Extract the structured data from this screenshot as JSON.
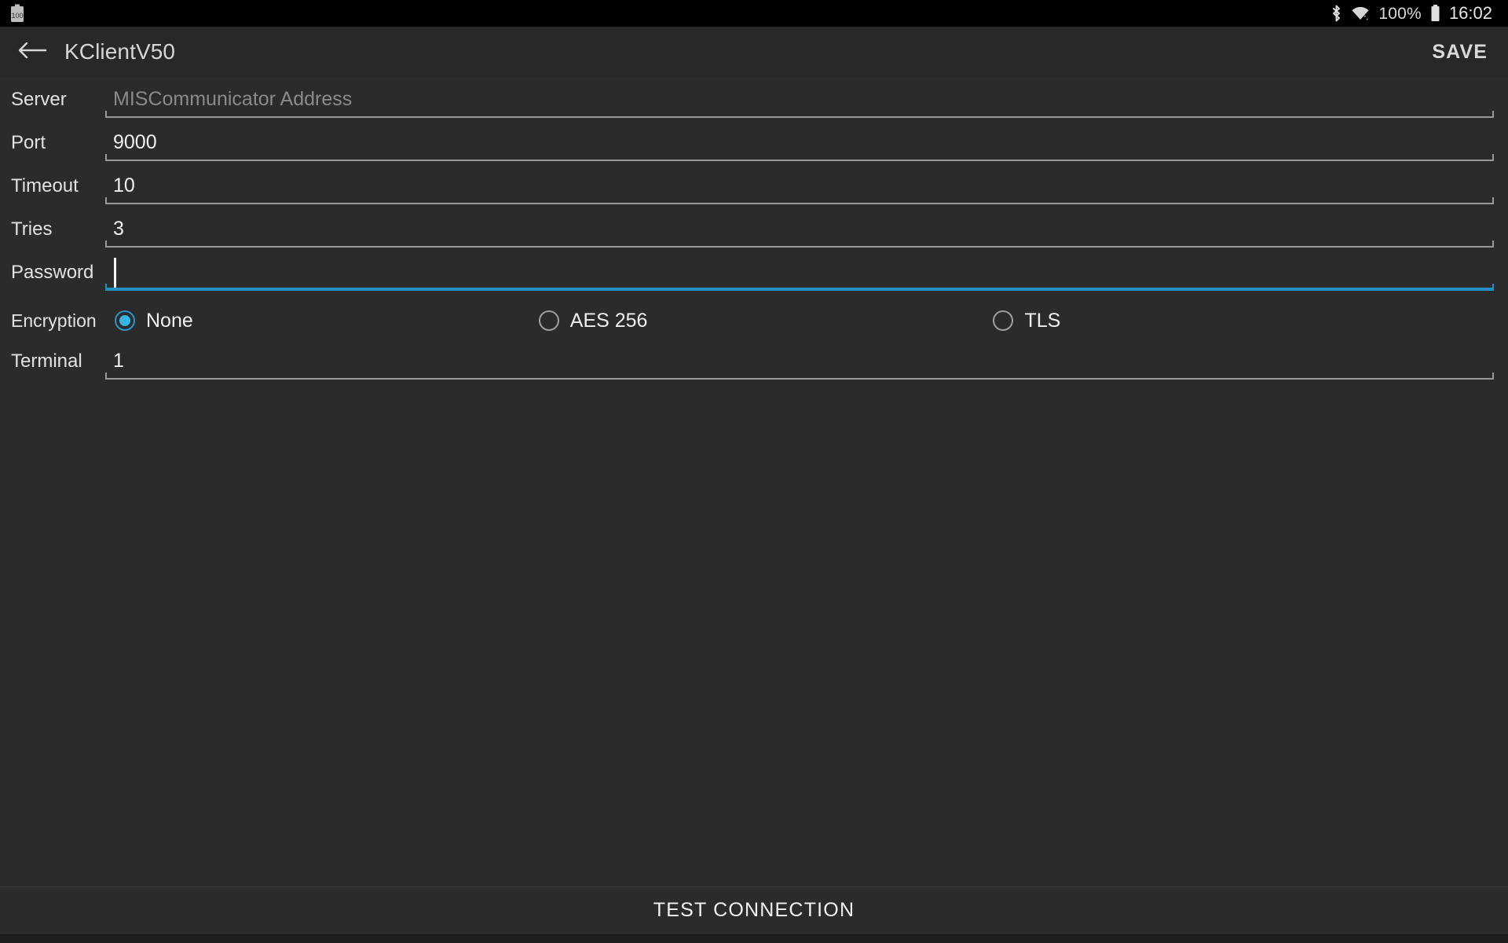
{
  "status_bar": {
    "left_icons": [
      {
        "name": "battery-saver-icon",
        "glyph": "100"
      }
    ],
    "bluetooth_icon": "bluetooth-icon",
    "wifi_icon": "wifi-icon",
    "battery_percent": "100%",
    "battery_icon": "battery-full-icon",
    "clock": "16:02"
  },
  "app_bar": {
    "back_icon": "back-arrow-icon",
    "title": "KClientV50",
    "save_label": "SAVE"
  },
  "form": {
    "fields": [
      {
        "label": "Server",
        "value": "",
        "placeholder": "MISCommunicator Address",
        "focused": false
      },
      {
        "label": "Port",
        "value": "9000",
        "placeholder": "",
        "focused": false
      },
      {
        "label": "Timeout",
        "value": "10",
        "placeholder": "",
        "focused": false
      },
      {
        "label": "Tries",
        "value": "3",
        "placeholder": "",
        "focused": false
      },
      {
        "label": "Password",
        "value": "",
        "placeholder": "",
        "focused": true
      }
    ],
    "encryption": {
      "label": "Encryption",
      "selected": "None",
      "options": [
        {
          "label": "None",
          "checked": true
        },
        {
          "label": "AES 256",
          "checked": false
        },
        {
          "label": "TLS",
          "checked": false
        }
      ]
    },
    "terminal": {
      "label": "Terminal",
      "value": "1",
      "placeholder": "",
      "focused": false
    }
  },
  "bottom_bar": {
    "test_connection_label": "TEST CONNECTION"
  },
  "colors": {
    "accent": "#33b5e5",
    "focus_underline": "#1f8fc4",
    "background": "#2b2b2b",
    "app_bar": "#282828",
    "status_bar": "#000000"
  }
}
